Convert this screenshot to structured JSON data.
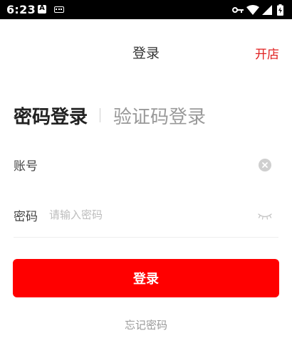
{
  "status_bar": {
    "time": "6:23",
    "notification_a": "A",
    "icons": [
      "a-notification-icon",
      "keyboard-icon",
      "vpn-key-icon",
      "wifi-icon",
      "cell-signal-icon",
      "battery-charging-icon"
    ]
  },
  "header": {
    "title": "登录",
    "right_action": "开店"
  },
  "tabs": {
    "active": "密码登录",
    "inactive": "验证码登录"
  },
  "form": {
    "account_label": "账号",
    "account_value": "",
    "password_label": "密码",
    "password_placeholder": "请输入密码"
  },
  "login_button": "登录",
  "forgot_password": "忘记密码",
  "colors": {
    "accent": "#ff0000",
    "header_action": "#e02020",
    "inactive_text": "#999999"
  }
}
